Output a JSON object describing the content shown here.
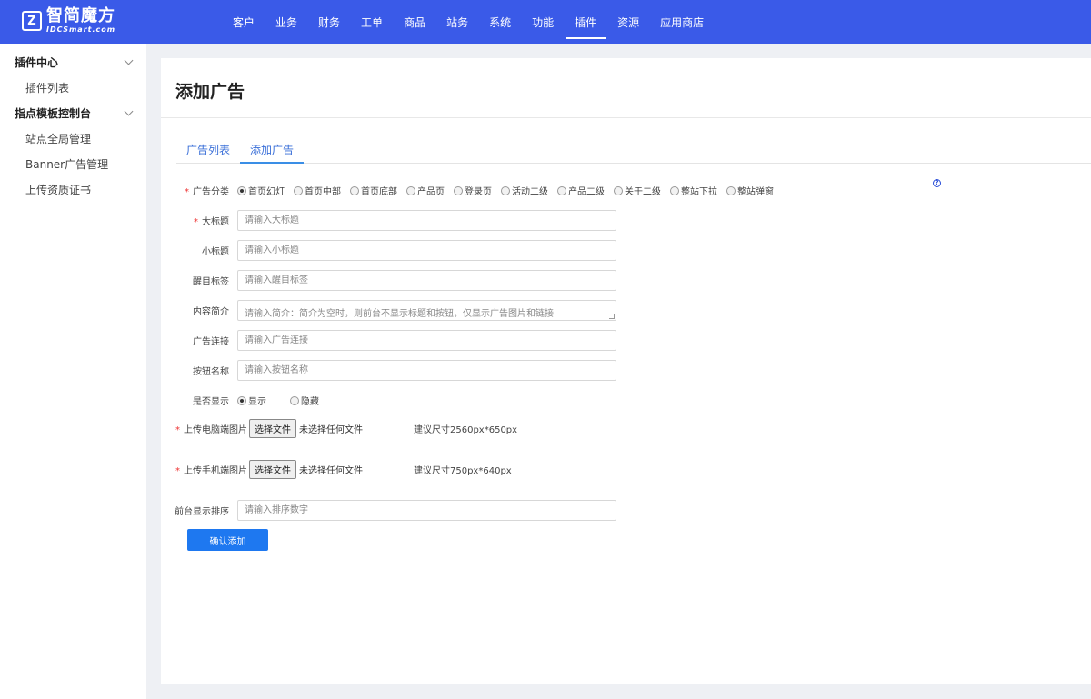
{
  "header": {
    "logo_cn": "智简魔方",
    "logo_en": "IDCSmart.com",
    "nav": [
      {
        "label": "客户",
        "active": false
      },
      {
        "label": "业务",
        "active": false
      },
      {
        "label": "财务",
        "active": false
      },
      {
        "label": "工单",
        "active": false
      },
      {
        "label": "商品",
        "active": false
      },
      {
        "label": "站务",
        "active": false
      },
      {
        "label": "系统",
        "active": false
      },
      {
        "label": "功能",
        "active": false
      },
      {
        "label": "插件",
        "active": true
      },
      {
        "label": "资源",
        "active": false
      },
      {
        "label": "应用商店",
        "active": false
      }
    ]
  },
  "sidebar": {
    "groups": [
      {
        "label": "插件中心",
        "items": [
          "插件列表"
        ]
      },
      {
        "label": "指点模板控制台",
        "items": [
          "站点全局管理",
          "Banner广告管理",
          "上传资质证书"
        ]
      }
    ]
  },
  "page": {
    "title": "添加广告",
    "tabs": [
      {
        "label": "广告列表",
        "active": false
      },
      {
        "label": "添加广告",
        "active": true
      }
    ]
  },
  "form": {
    "category": {
      "label": "广告分类",
      "required": true,
      "options": [
        "首页幻灯",
        "首页中部",
        "首页底部",
        "产品页",
        "登录页",
        "活动二级",
        "产品二级",
        "关于二级",
        "整站下拉",
        "整站弹窗"
      ],
      "selected": "首页幻灯"
    },
    "title": {
      "label": "大标题",
      "required": true,
      "placeholder": "请输入大标题"
    },
    "subtitle": {
      "label": "小标题",
      "placeholder": "请输入小标题"
    },
    "tag": {
      "label": "醒目标签",
      "placeholder": "请输入醒目标签"
    },
    "intro": {
      "label": "内容简介",
      "placeholder": "请输入简介：简介为空时，则前台不显示标题和按钮，仅显示广告图片和链接"
    },
    "link": {
      "label": "广告连接",
      "placeholder": "请输入广告连接"
    },
    "button_name": {
      "label": "按钮名称",
      "placeholder": "请输入按钮名称"
    },
    "visible": {
      "label": "是否显示",
      "options": [
        "显示",
        "隐藏"
      ],
      "selected": "显示"
    },
    "pc_image": {
      "label": "上传电脑端图片",
      "required": true,
      "button": "选择文件",
      "status": "未选择任何文件",
      "hint": "建议尺寸2560px*650px"
    },
    "mobile_image": {
      "label": "上传手机端图片",
      "required": true,
      "button": "选择文件",
      "status": "未选择任何文件",
      "hint": "建议尺寸750px*640px"
    },
    "order": {
      "label": "前台显示排序",
      "placeholder": "请输入排序数字"
    },
    "submit_label": "确认添加",
    "help_icon": "question-circle-icon"
  }
}
